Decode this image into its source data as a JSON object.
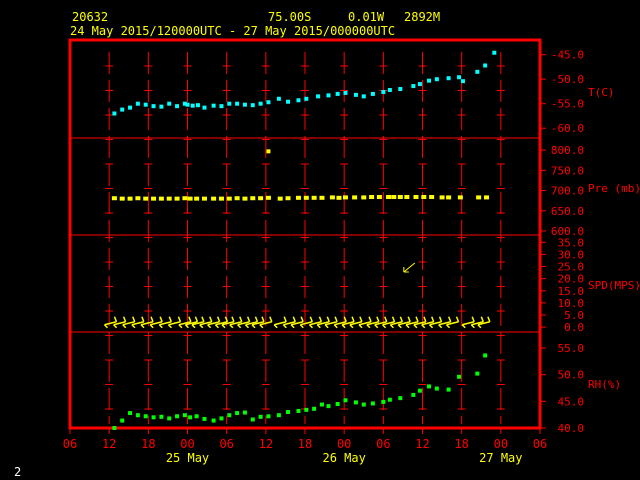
{
  "header": {
    "station": "20632",
    "lat": "75.00S",
    "lon": "0.01W",
    "elev": "2892M",
    "time_range": "24 May 2015/120000UTC - 27 May 2015/000000UTC"
  },
  "page_number": "2",
  "colors": {
    "frame": "#ff0000",
    "labels": "#ff0000",
    "text": "#ffff00",
    "temp": "#00ffff",
    "pressure": "#ffff00",
    "wind": "#ffff00",
    "rh": "#00ff00"
  },
  "chart_data": {
    "type": "scatter",
    "x_axis": {
      "unit": "hours since 24 May 2015 06UTC",
      "range": [
        0,
        72
      ],
      "tick_labels": [
        "06",
        "12",
        "18",
        "00",
        "06",
        "12",
        "18",
        "00",
        "06",
        "12",
        "18",
        "00",
        "06"
      ],
      "date_labels": [
        {
          "hour": 18,
          "text": "25 May"
        },
        {
          "hour": 42,
          "text": "26 May"
        },
        {
          "hour": 66,
          "text": "27 May"
        }
      ]
    },
    "panels": [
      {
        "name": "temperature",
        "label": "T(C)",
        "range": [
          -62,
          -42
        ],
        "ticks": [
          -45,
          -50,
          -55,
          -60
        ],
        "tick_labels": [
          "-45.0",
          "-50.0",
          "-55.0",
          "-60.0"
        ],
        "series": {
          "x": [
            6.8,
            8,
            9.2,
            10.4,
            11.6,
            12.8,
            14,
            15.2,
            16.4,
            17.6,
            18,
            18.8,
            19.6,
            20.6,
            22,
            23.2,
            24.4,
            25.6,
            26.8,
            28,
            29.2,
            30.4,
            32,
            33.4,
            35,
            36.2,
            38,
            39.6,
            41,
            42.2,
            43.8,
            45,
            46.4,
            48,
            49,
            50.6,
            52.6,
            53.6,
            55,
            56.2,
            58,
            59.6,
            60.2,
            62.4,
            63.6,
            65
          ],
          "y": [
            -57,
            -56.2,
            -55.8,
            -55,
            -55.2,
            -55.5,
            -55.6,
            -55,
            -55.5,
            -55,
            -55.2,
            -55.4,
            -55.3,
            -55.8,
            -55.4,
            -55.5,
            -55,
            -55,
            -55.2,
            -55.3,
            -55,
            -54.7,
            -54,
            -54.6,
            -54.3,
            -54,
            -53.5,
            -53.3,
            -53,
            -52.8,
            -53.2,
            -53.5,
            -53,
            -52.6,
            -52.2,
            -52,
            -51.4,
            -51,
            -50.3,
            -50,
            -49.8,
            -49.6,
            -50.4,
            -48.5,
            -47.2,
            -44.6
          ]
        }
      },
      {
        "name": "pressure",
        "label": "Pre (mb)",
        "range": [
          590,
          830
        ],
        "ticks": [
          600,
          650,
          700,
          750,
          800
        ],
        "tick_labels": [
          "600.0",
          "650.0",
          "700.0",
          "750.0",
          "800.0"
        ],
        "series": {
          "x": [
            6.8,
            8,
            9.2,
            10.4,
            11.6,
            12.8,
            14,
            15.2,
            16.4,
            17.6,
            18.4,
            19.4,
            20.6,
            22,
            23.2,
            24.4,
            25.6,
            26.8,
            28,
            29.2,
            30.4,
            32.2,
            33.4,
            35,
            36.2,
            37.4,
            38.6,
            40.2,
            41.2,
            42.2,
            43.6,
            45,
            46.2,
            47.4,
            48.8,
            49.6,
            50.6,
            51.6,
            53,
            54.2,
            55.4,
            57,
            58,
            59.8,
            62.6,
            63.8
          ],
          "y": [
            681,
            680,
            680,
            681,
            680,
            680,
            680,
            680,
            680,
            681,
            680,
            680,
            680,
            680,
            680,
            680,
            681,
            680,
            681,
            681,
            682,
            680,
            681,
            682,
            682,
            682,
            682,
            683,
            682,
            683,
            683,
            683,
            684,
            684,
            684,
            684,
            684,
            684,
            684,
            684,
            684,
            683,
            683,
            683,
            683,
            683
          ],
          "outlier": {
            "x": 30.4,
            "y": 797
          }
        }
      },
      {
        "name": "wind",
        "label": "SPD(MPS)",
        "range": [
          -2,
          38
        ],
        "ticks": [
          0,
          5,
          10,
          15,
          20,
          25,
          30,
          35
        ],
        "tick_labels": [
          "0.0",
          "5.0",
          "10.0",
          "15.0",
          "20.0",
          "25.0",
          "30.0",
          "35.0"
        ],
        "barbs_x": [
          6.2,
          7.6,
          9,
          10.4,
          11.8,
          13.2,
          14.6,
          16,
          17.6,
          18.6,
          19.6,
          20.8,
          22,
          23.2,
          24.2,
          25.4,
          26.6,
          27.8,
          28.8,
          30,
          32.2,
          33.6,
          34.8,
          36.2,
          37.6,
          38.8,
          40,
          41.4,
          42.6,
          43.8,
          45.2,
          46.4,
          47.6,
          48.8,
          50,
          51.2,
          52.4,
          53.6,
          54.8,
          56,
          57.4,
          58.6,
          61,
          62.4,
          63.4
        ],
        "barbs_y": [
          1,
          1,
          1,
          1,
          1,
          1,
          1,
          1,
          1,
          1,
          1,
          1,
          1,
          1,
          1,
          1,
          1,
          1,
          1,
          1,
          1,
          1,
          1,
          1,
          1,
          1,
          1,
          1,
          1,
          1,
          1,
          1,
          1,
          1,
          1,
          1,
          1,
          1,
          1,
          1,
          1,
          1,
          1,
          1,
          1
        ],
        "arrow": {
          "x": 51.6,
          "y": 24
        }
      },
      {
        "name": "humidity",
        "label": "RH(%)",
        "range": [
          40,
          58
        ],
        "ticks": [
          40,
          45,
          50,
          55
        ],
        "tick_labels": [
          "40.0",
          "45.0",
          "50.0",
          "55.0"
        ],
        "series": {
          "x": [
            6.8,
            8,
            9.2,
            10.4,
            11.6,
            12.8,
            14,
            15.2,
            16.4,
            17.6,
            18.4,
            19.4,
            20.6,
            22,
            23.2,
            24.4,
            25.6,
            26.8,
            28,
            29.2,
            30.4,
            32,
            33.4,
            35,
            36.2,
            37.4,
            38.6,
            39.6,
            41,
            42.2,
            43.8,
            45,
            46.4,
            48,
            49,
            50.6,
            52.6,
            53.6,
            55,
            56.2,
            58,
            59.6,
            62.4,
            63.6
          ],
          "y": [
            40,
            41.4,
            42.8,
            42.4,
            42.2,
            42,
            42.1,
            41.8,
            42.2,
            42.4,
            42,
            42.2,
            41.7,
            41.4,
            41.8,
            42.4,
            42.8,
            42.9,
            41.6,
            42.1,
            42.2,
            42.4,
            43,
            43.2,
            43.4,
            43.6,
            44.4,
            44.1,
            44.5,
            45.2,
            44.8,
            44.4,
            44.6,
            44.9,
            45.3,
            45.6,
            46.2,
            47,
            47.8,
            47.4,
            47.2,
            49.6,
            50.2,
            53.6
          ]
        }
      }
    ]
  }
}
